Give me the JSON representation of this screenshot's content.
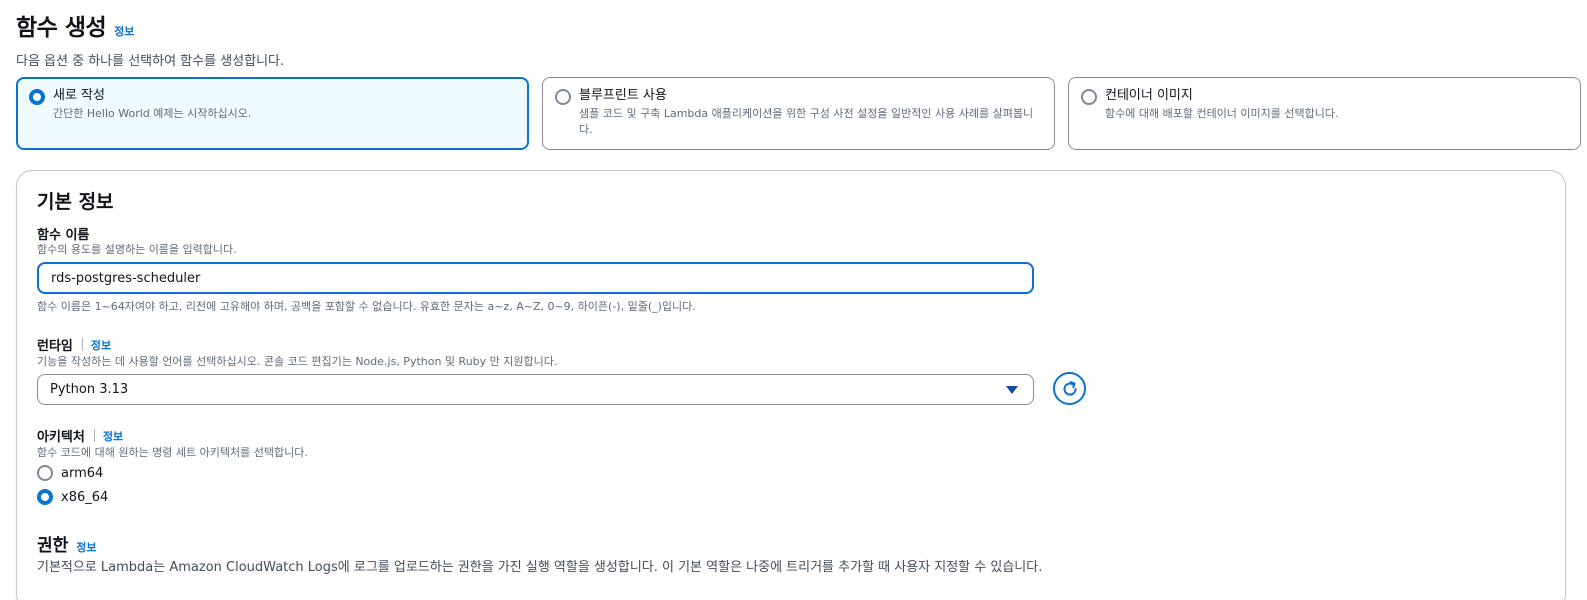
{
  "header": {
    "title": "함수 생성",
    "info": "정보",
    "description": "다음 옵션 중 하나를 선택하여 함수를 생성합니다."
  },
  "options": [
    {
      "title": "새로 작성",
      "description": "간단한 Hello World 예제는 시작하십시오.",
      "selected": true
    },
    {
      "title": "블루프린트 사용",
      "description": "샘플 코드 및 구축 Lambda 애플리케이션을 위한 구성 사전 설정을 일반적인 사용 사례를 살펴봅니다.",
      "selected": false
    },
    {
      "title": "컨테이너 이미지",
      "description": "함수에 대해 배포할 컨테이너 이미지를 선택합니다.",
      "selected": false
    }
  ],
  "basic": {
    "title": "기본 정보",
    "function_name": {
      "label": "함수 이름",
      "description": "함수의 용도를 설명하는 이름을 입력합니다.",
      "value": "rds-postgres-scheduler",
      "constraint": "함수 이름은 1~64자여야 하고, 리전에 고유해야 하며, 공백을 포함할 수 없습니다. 유효한 문자는 a~z, A~Z, 0~9, 하이픈(-), 밑줄(_)입니다."
    },
    "runtime": {
      "label": "런타임",
      "info": "정보",
      "description": "기능을 작성하는 데 사용할 언어를 선택하십시오. 콘솔 코드 편집기는 Node.js, Python 및 Ruby 만 지원합니다.",
      "selected": "Python 3.13"
    },
    "architecture": {
      "label": "아키텍처",
      "info": "정보",
      "description": "함수 코드에 대해 원하는 명령 세트 아키텍처를 선택합니다.",
      "options": [
        "arm64",
        "x86_64"
      ],
      "selected": "x86_64"
    },
    "permissions": {
      "title": "권한",
      "info": "정보",
      "description": "기본적으로 Lambda는 Amazon CloudWatch Logs에 로그를 업로드하는 권한을 가진 실행 역할을 생성합니다. 이 기본 역할은 나중에 트리거를 추가할 때 사용자 지정할 수 있습니다."
    }
  },
  "colors": {
    "accent": "#0972d3",
    "selected_bg": "#f0fbff"
  }
}
